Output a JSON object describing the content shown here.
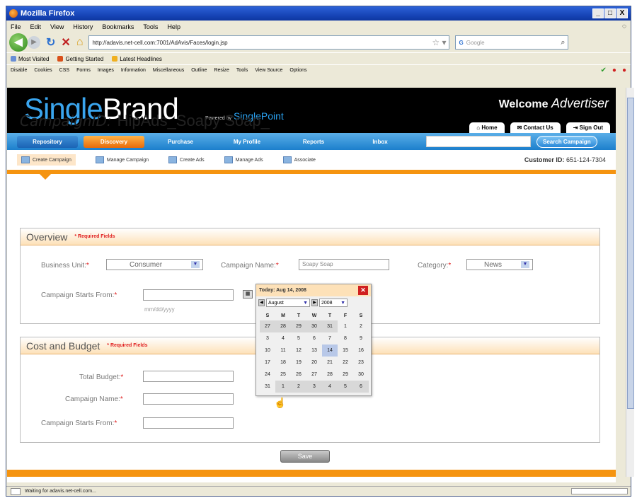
{
  "window": {
    "title": "Mozilla Firefox",
    "buttons": [
      "_",
      "□",
      "X"
    ]
  },
  "menu": [
    "File",
    "Edit",
    "View",
    "History",
    "Bookmarks",
    "Tools",
    "Help"
  ],
  "nav": {
    "url": "http://adavis.net-cell.com:7001/AdAvis/Faces/login.jsp",
    "search_placeholder": "Google",
    "search_engine": "G"
  },
  "bookmarks": [
    "Most Visited",
    "Getting Started",
    "Latest Headlines"
  ],
  "devbar": [
    "Disable",
    "Cookies",
    "CSS",
    "Forms",
    "Images",
    "Information",
    "Miscellaneous",
    "Outline",
    "Resize",
    "Tools",
    "View Source",
    "Options"
  ],
  "site": {
    "logo_a": "Single",
    "logo_b": "Brand",
    "powered_by": "Powered by",
    "powered_name": "SinglePoint",
    "welcome": "Welcome",
    "welcome_user": "Advertiser",
    "top_tabs": [
      "Home",
      "Contact Us",
      "Sign Out"
    ],
    "main_nav": [
      "Repository",
      "Discovery",
      "Purchase",
      "My Profile",
      "Reports",
      "Inbox"
    ],
    "main_nav_active": "Discovery",
    "search_button": "Search Campaign",
    "sub_nav": [
      "Create Campaign",
      "Manage Campaign",
      "Create Ads",
      "Manage Ads",
      "Associate"
    ],
    "customer_label": "Customer ID:",
    "customer_id": "651-124-7304"
  },
  "campaign": {
    "id_label": "CampaignID:",
    "id_value": "HipAds_Soapy Soap_"
  },
  "overview": {
    "title": "Overview",
    "required": "* Required Fields",
    "business_unit_label": "Business Unit:",
    "business_unit_value": "Consumer",
    "campaign_name_label": "Campaign Name:",
    "campaign_name_value": "Soapy Soap",
    "category_label": "Category:",
    "category_value": "News",
    "starts_label": "Campaign Starts From:",
    "date_hint": "mm/dd/yyyy"
  },
  "calendar": {
    "header": "Today: Aug 14, 2008",
    "month": "August",
    "year": "2008",
    "weekdays": [
      "S",
      "M",
      "T",
      "W",
      "T",
      "F",
      "S"
    ],
    "weeks": [
      [
        "27",
        "28",
        "29",
        "30",
        "31",
        "1",
        "2"
      ],
      [
        "3",
        "4",
        "5",
        "6",
        "7",
        "8",
        "9"
      ],
      [
        "10",
        "11",
        "12",
        "13",
        "14",
        "15",
        "16"
      ],
      [
        "17",
        "18",
        "19",
        "20",
        "21",
        "22",
        "23"
      ],
      [
        "24",
        "25",
        "26",
        "27",
        "28",
        "29",
        "30"
      ],
      [
        "31",
        "1",
        "2",
        "3",
        "4",
        "5",
        "6"
      ]
    ]
  },
  "cost": {
    "title": "Cost and Budget",
    "required": "* Required Fields",
    "total_budget_label": "Total Budget:",
    "campaign_name_label": "Campaign Name:",
    "starts_label": "Campaign Starts From:"
  },
  "save_label": "Save",
  "status_text": "Waiting for adavis.net-cell.com..."
}
